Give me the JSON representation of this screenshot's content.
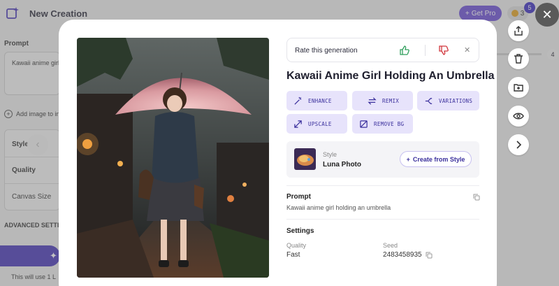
{
  "app": {
    "title": "New Creation",
    "get_pro_label": "Get Pro",
    "coins": "3",
    "notifications": "5"
  },
  "sidebar": {
    "prompt_label": "Prompt",
    "prompt_value": "Kawaii anime girl",
    "add_image_label": "Add image to in",
    "options": [
      {
        "label": "Style"
      },
      {
        "label": "Quality"
      },
      {
        "label": "Canvas Size"
      }
    ],
    "advanced_label": "ADVANCED SETTI",
    "credit_note": "This will use 1 L"
  },
  "right_panel": {
    "slider_value": "4"
  },
  "rail": [
    {
      "icon": "share-icon"
    },
    {
      "icon": "trash-icon"
    },
    {
      "icon": "folder-icon"
    },
    {
      "icon": "eye-icon"
    },
    {
      "icon": "chevron-right-icon"
    }
  ],
  "modal": {
    "rate_label": "Rate this generation",
    "title": "Kawaii Anime Girl Holding An Umbrella",
    "tools": [
      {
        "label": "ENHANCE",
        "icon": "magic-wand-icon"
      },
      {
        "label": "REMIX",
        "icon": "remix-icon"
      },
      {
        "label": "VARIATIONS",
        "icon": "variations-icon"
      },
      {
        "label": "UPSCALE",
        "icon": "upscale-icon"
      },
      {
        "label": "REMOVE BG",
        "icon": "remove-bg-icon"
      }
    ],
    "style": {
      "kicker": "Style",
      "name": "Luna Photo",
      "create_label": "Create from Style"
    },
    "prompt_heading": "Prompt",
    "prompt_text": "Kawaii anime girl holding an umbrella",
    "settings_heading": "Settings",
    "quality_key": "Quality",
    "quality_value": "Fast",
    "seed_key": "Seed",
    "seed_value": "2483458935"
  },
  "colors": {
    "accent": "#6b4fd6",
    "tool_bg": "#e7e3fb",
    "tool_text": "#3a2f9c",
    "thumbs_up": "#2e9e5b",
    "thumbs_down": "#d0333a"
  }
}
